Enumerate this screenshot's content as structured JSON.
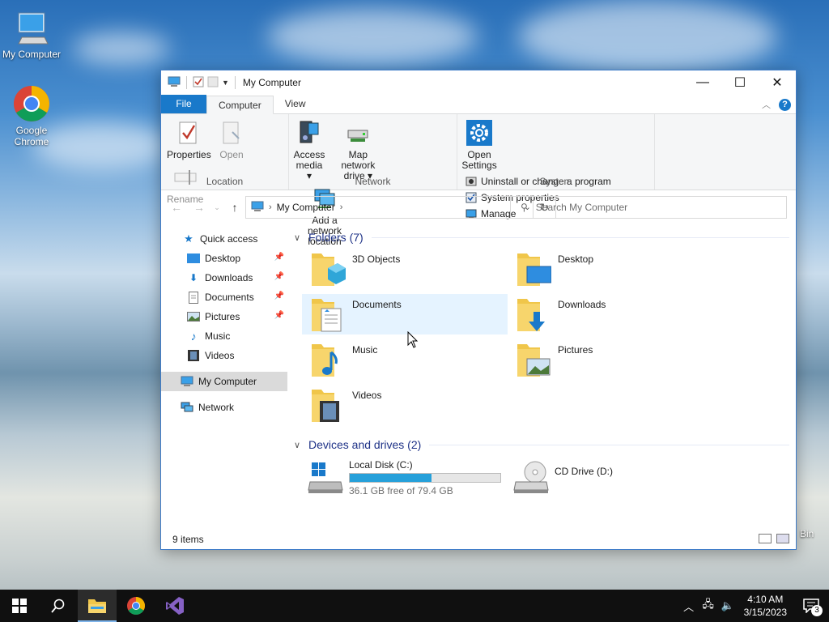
{
  "desktop": {
    "icons": [
      {
        "label": "My Computer"
      },
      {
        "label": "Google Chrome"
      }
    ],
    "recycle_bin_partial": "Bin"
  },
  "window": {
    "title": "My Computer",
    "tabs": {
      "file": "File",
      "computer": "Computer",
      "view": "View"
    },
    "help": "?",
    "ribbon": {
      "location": {
        "name": "Location",
        "buttons": [
          {
            "label": "Properties",
            "enabled": true
          },
          {
            "label": "Open",
            "enabled": false
          },
          {
            "label": "Rename",
            "enabled": false
          }
        ]
      },
      "network": {
        "name": "Network",
        "buttons": [
          {
            "label": "Access media ▾"
          },
          {
            "label": "Map network drive ▾"
          },
          {
            "label": "Add a network location"
          }
        ]
      },
      "system": {
        "name": "System",
        "open_settings": "Open Settings",
        "items": [
          {
            "label": "Uninstall or change a program"
          },
          {
            "label": "System properties"
          },
          {
            "label": "Manage"
          }
        ]
      }
    },
    "address": {
      "path": "My Computer"
    },
    "search": {
      "placeholder": "Search My Computer"
    },
    "nav": {
      "quick_access": "Quick access",
      "items": [
        {
          "label": "Desktop",
          "pinned": true
        },
        {
          "label": "Downloads",
          "pinned": true
        },
        {
          "label": "Documents",
          "pinned": true
        },
        {
          "label": "Pictures",
          "pinned": true
        },
        {
          "label": "Music",
          "pinned": false
        },
        {
          "label": "Videos",
          "pinned": false
        }
      ],
      "my_computer": "My Computer",
      "network": "Network"
    },
    "folders": {
      "header": "Folders (7)",
      "items": [
        {
          "label": "3D Objects"
        },
        {
          "label": "Desktop"
        },
        {
          "label": "Documents"
        },
        {
          "label": "Downloads"
        },
        {
          "label": "Music"
        },
        {
          "label": "Pictures"
        },
        {
          "label": "Videos"
        }
      ]
    },
    "devices": {
      "header": "Devices and drives (2)",
      "local_disk": {
        "label": "Local Disk (C:)",
        "free_text": "36.1 GB free of 79.4 GB",
        "used_fraction": 0.545
      },
      "cd_drive": {
        "label": "CD Drive (D:)"
      }
    },
    "status": {
      "items": "9 items"
    }
  },
  "taskbar": {
    "time": "4:10 AM",
    "date": "3/15/2023",
    "notifications": "3"
  }
}
